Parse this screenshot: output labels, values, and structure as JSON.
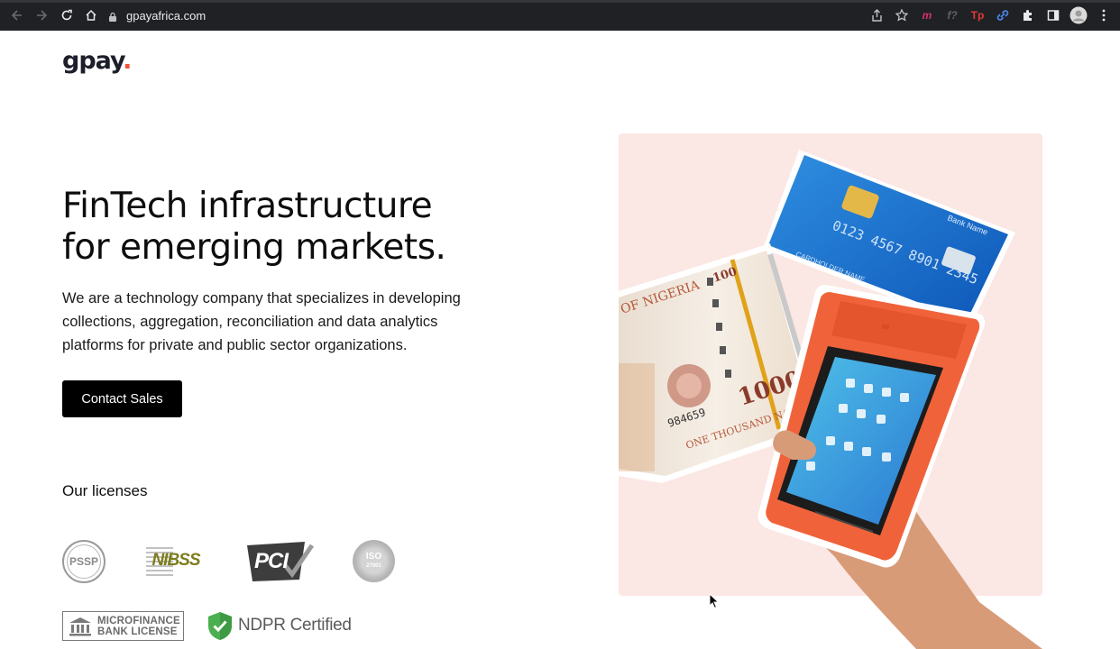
{
  "browser": {
    "url": "gpayafrica.com",
    "extensions": [
      "m",
      "f?",
      "Tp"
    ]
  },
  "brand": {
    "logo_text": "gpay",
    "logo_dot": ".",
    "accent_color": "#f2533b"
  },
  "hero": {
    "title_line1": "FinTech infrastructure",
    "title_line2": "for emerging markets.",
    "description": "We are a technology company that specializes in developing collections, aggregation, reconciliation and data analytics platforms for private and public sector organizations.",
    "cta_label": "Contact Sales"
  },
  "licenses": {
    "heading": "Our licenses",
    "pssp": "PSSP",
    "nibss": "NIBSS",
    "pci": "PCI",
    "iso": "ISO",
    "iso_sub": "27001",
    "mfb_line1": "MICROFINANCE",
    "mfb_line2": "BANK LICENSE",
    "ndpr": "NDPR Certified"
  },
  "illustration": {
    "card_number": "0123 4567 8901 2345",
    "card_bank": "Bank Name",
    "card_holder": "CARDHOLDER NAME",
    "note_country": "OF NIGERIA",
    "note_value": "1000",
    "note_small_value": "100",
    "note_serial": "984659",
    "note_words": "ONE THOUSAND NAIRA"
  }
}
